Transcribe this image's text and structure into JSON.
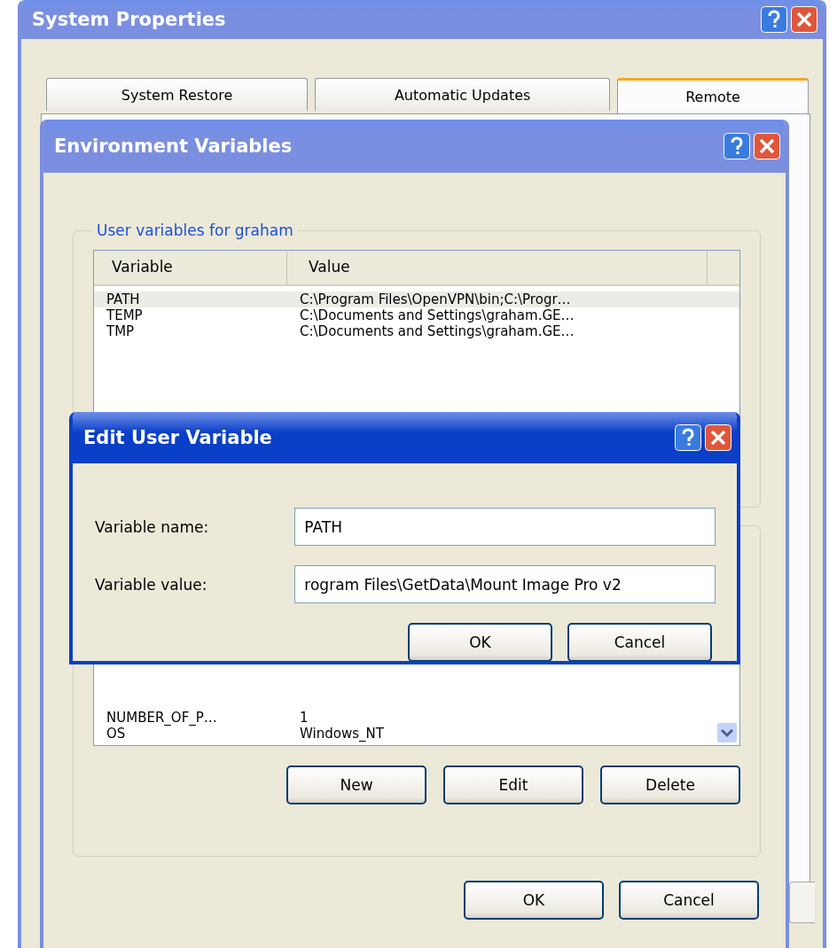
{
  "system_properties": {
    "title": "System Properties",
    "active": false,
    "tabs": [
      {
        "label": "System Restore",
        "selected": false
      },
      {
        "label": "Automatic Updates",
        "selected": false
      },
      {
        "label": "Remote",
        "selected": true
      }
    ]
  },
  "environment_variables": {
    "title": "Environment Variables",
    "active": false,
    "user_variables": {
      "legend": "User variables for graham",
      "columns": [
        "Variable",
        "Value"
      ],
      "rows": [
        {
          "variable": "PATH",
          "value": "C:\\Program Files\\OpenVPN\\bin;C:\\Progr…",
          "selected": true
        },
        {
          "variable": "TEMP",
          "value": "C:\\Documents and Settings\\graham.GE…",
          "selected": false
        },
        {
          "variable": "TMP",
          "value": "C:\\Documents and Settings\\graham.GE…",
          "selected": false
        }
      ]
    },
    "system_variables": {
      "rows": [
        {
          "variable": "NUMBER_OF_P…",
          "value": "1",
          "selected": false
        },
        {
          "variable": "OS",
          "value": "Windows_NT",
          "selected": false
        }
      ],
      "buttons": [
        "New",
        "Edit",
        "Delete"
      ]
    },
    "buttons": [
      "OK",
      "Cancel"
    ]
  },
  "edit_user_variable": {
    "title": "Edit User Variable",
    "active": true,
    "fields": [
      {
        "label": "Variable name:",
        "value": "PATH"
      },
      {
        "label": "Variable value:",
        "value": "rogram Files\\GetData\\Mount Image Pro v2"
      }
    ],
    "buttons": [
      "OK",
      "Cancel"
    ]
  }
}
